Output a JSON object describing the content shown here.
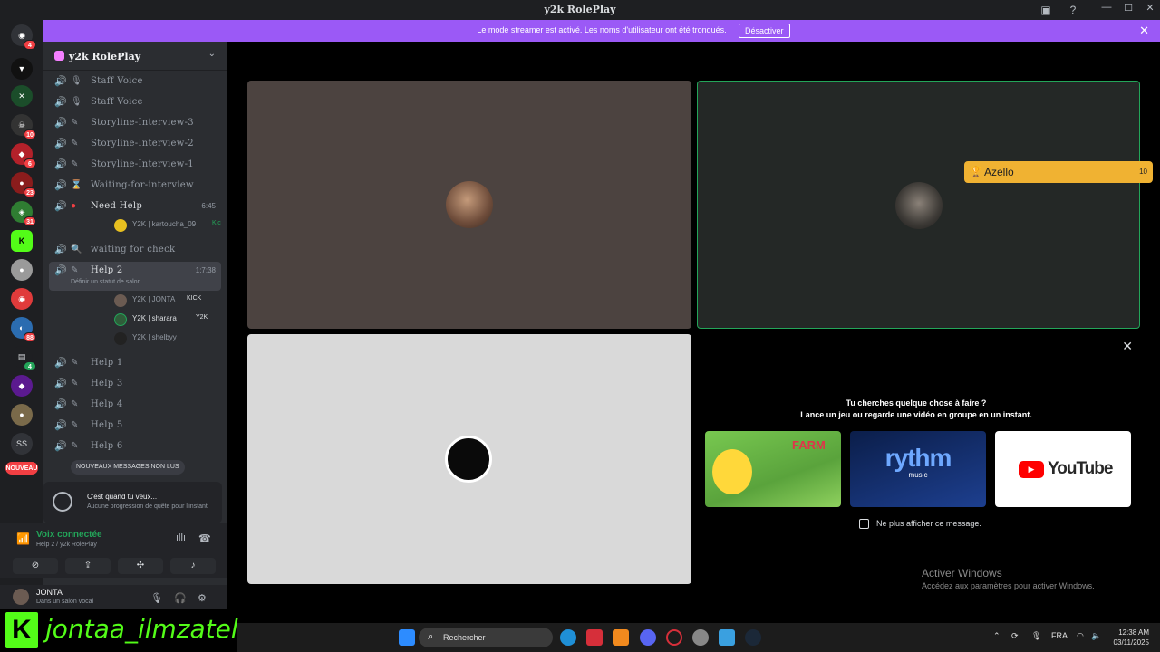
{
  "window": {
    "title": "y2k RolePlay"
  },
  "banner": {
    "message": "Le mode streamer est activé. Les noms d'utilisateur ont été tronqués.",
    "button": "Désactiver"
  },
  "rail": {
    "badges": [
      "4",
      "10",
      "6",
      "23",
      "31",
      "88",
      "4"
    ],
    "text_servers": [
      "SS",
      "NOUVEAU"
    ]
  },
  "server": {
    "name": "y2k RolePlay"
  },
  "channels": [
    {
      "name": "Staff Voice",
      "time": ""
    },
    {
      "name": "Staff Voice",
      "time": ""
    },
    {
      "name": "Storyline-Interview-3",
      "time": ""
    },
    {
      "name": "Storyline-Interview-2",
      "time": ""
    },
    {
      "name": "Storyline-Interview-1",
      "time": ""
    },
    {
      "name": "Waiting-for-interview",
      "time": ""
    },
    {
      "name": "Need Help",
      "time": "6:45"
    },
    {
      "name": "waiting for check",
      "time": ""
    },
    {
      "name": "Help 2",
      "time": "1:7:38"
    },
    {
      "name": "Help 1",
      "time": ""
    },
    {
      "name": "Help 3",
      "time": ""
    },
    {
      "name": "Help 4",
      "time": ""
    },
    {
      "name": "Help 5",
      "time": ""
    },
    {
      "name": "Help 6",
      "time": ""
    }
  ],
  "need_help_user": {
    "name": "Y2K | kartoucha_09",
    "tag": "Kic"
  },
  "help2_status": "Définir un statut de salon",
  "help2_users": [
    {
      "name": "Y2K | JONTA",
      "tag": "KICK"
    },
    {
      "name": "Y2K | sharara",
      "tag": "Y2K"
    },
    {
      "name": "Y2K | shelbyy",
      "tag": ""
    }
  ],
  "new_messages": "NOUVEAUX MESSAGES NON LUS",
  "quest": {
    "title": "C'est quand tu veux...",
    "subtitle": "Aucune progression de quête pour l'instant"
  },
  "voice": {
    "status": "Voix connectée",
    "location": "Help 2 / y2k RolePlay"
  },
  "user": {
    "name": "JONTA",
    "status": "Dans un salon vocal"
  },
  "speaker": {
    "name": "Azello",
    "count": "10"
  },
  "activity": {
    "heading": "Tu cherches quelque chose à faire ?",
    "subheading": "Lance un jeu ou regarde une vidéo en groupe en un instant.",
    "cards": [
      "Farm Merge Valley",
      "rythm music",
      "YouTube"
    ],
    "checkbox": "Ne plus afficher ce message."
  },
  "watermark": {
    "title": "Activer Windows",
    "subtitle": "Accédez aux paramètres pour activer Windows."
  },
  "overlay": {
    "kick_letter": "K",
    "name": "jontaa_ilmzatel"
  },
  "taskbar": {
    "search": "Rechercher",
    "lang": "FRA",
    "time": "12:38 AM",
    "date": "03/11/2025"
  }
}
